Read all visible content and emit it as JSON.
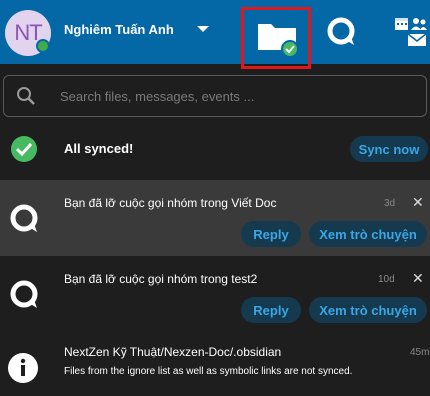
{
  "header": {
    "avatar_initials": "NT",
    "user_name": "Nghiêm Tuấn Anh",
    "online_status_color": "#3fae4a",
    "apps": [
      {
        "name": "files",
        "icon": "folder-synced-icon",
        "selected": true
      },
      {
        "name": "talk",
        "icon": "talk-icon"
      },
      {
        "name": "activity",
        "icon": "calendar-contacts-mail-icon"
      }
    ]
  },
  "search": {
    "placeholder": "Search files, messages, events ..."
  },
  "sync": {
    "status_text": "All synced!",
    "sync_now_label": "Sync now"
  },
  "activities": [
    {
      "icon": "talk-icon",
      "message": "Bạn đã lỡ cuộc gọi nhóm trong Viết Doc",
      "time": "3d",
      "reply_label": "Reply",
      "view_label": "Xem trò chuyện",
      "close": "✕"
    },
    {
      "icon": "talk-icon",
      "message": "Bạn đã lỡ cuộc gọi nhóm trong test2",
      "time": "10d",
      "reply_label": "Reply",
      "view_label": "Xem trò chuyện",
      "close": "✕"
    },
    {
      "icon": "info-icon",
      "message": "NextZen Kỹ Thuật/Nexzen-Doc/.obsidian",
      "detail": "Files from the ignore list as well as symbolic links are not synced.",
      "time": "45m"
    }
  ],
  "colors": {
    "header_bg": "#0568a6",
    "accent": "#3aa6e6",
    "success": "#46ba61",
    "highlight_row": "#3a3a3a",
    "selection_outline": "#e0171c"
  }
}
